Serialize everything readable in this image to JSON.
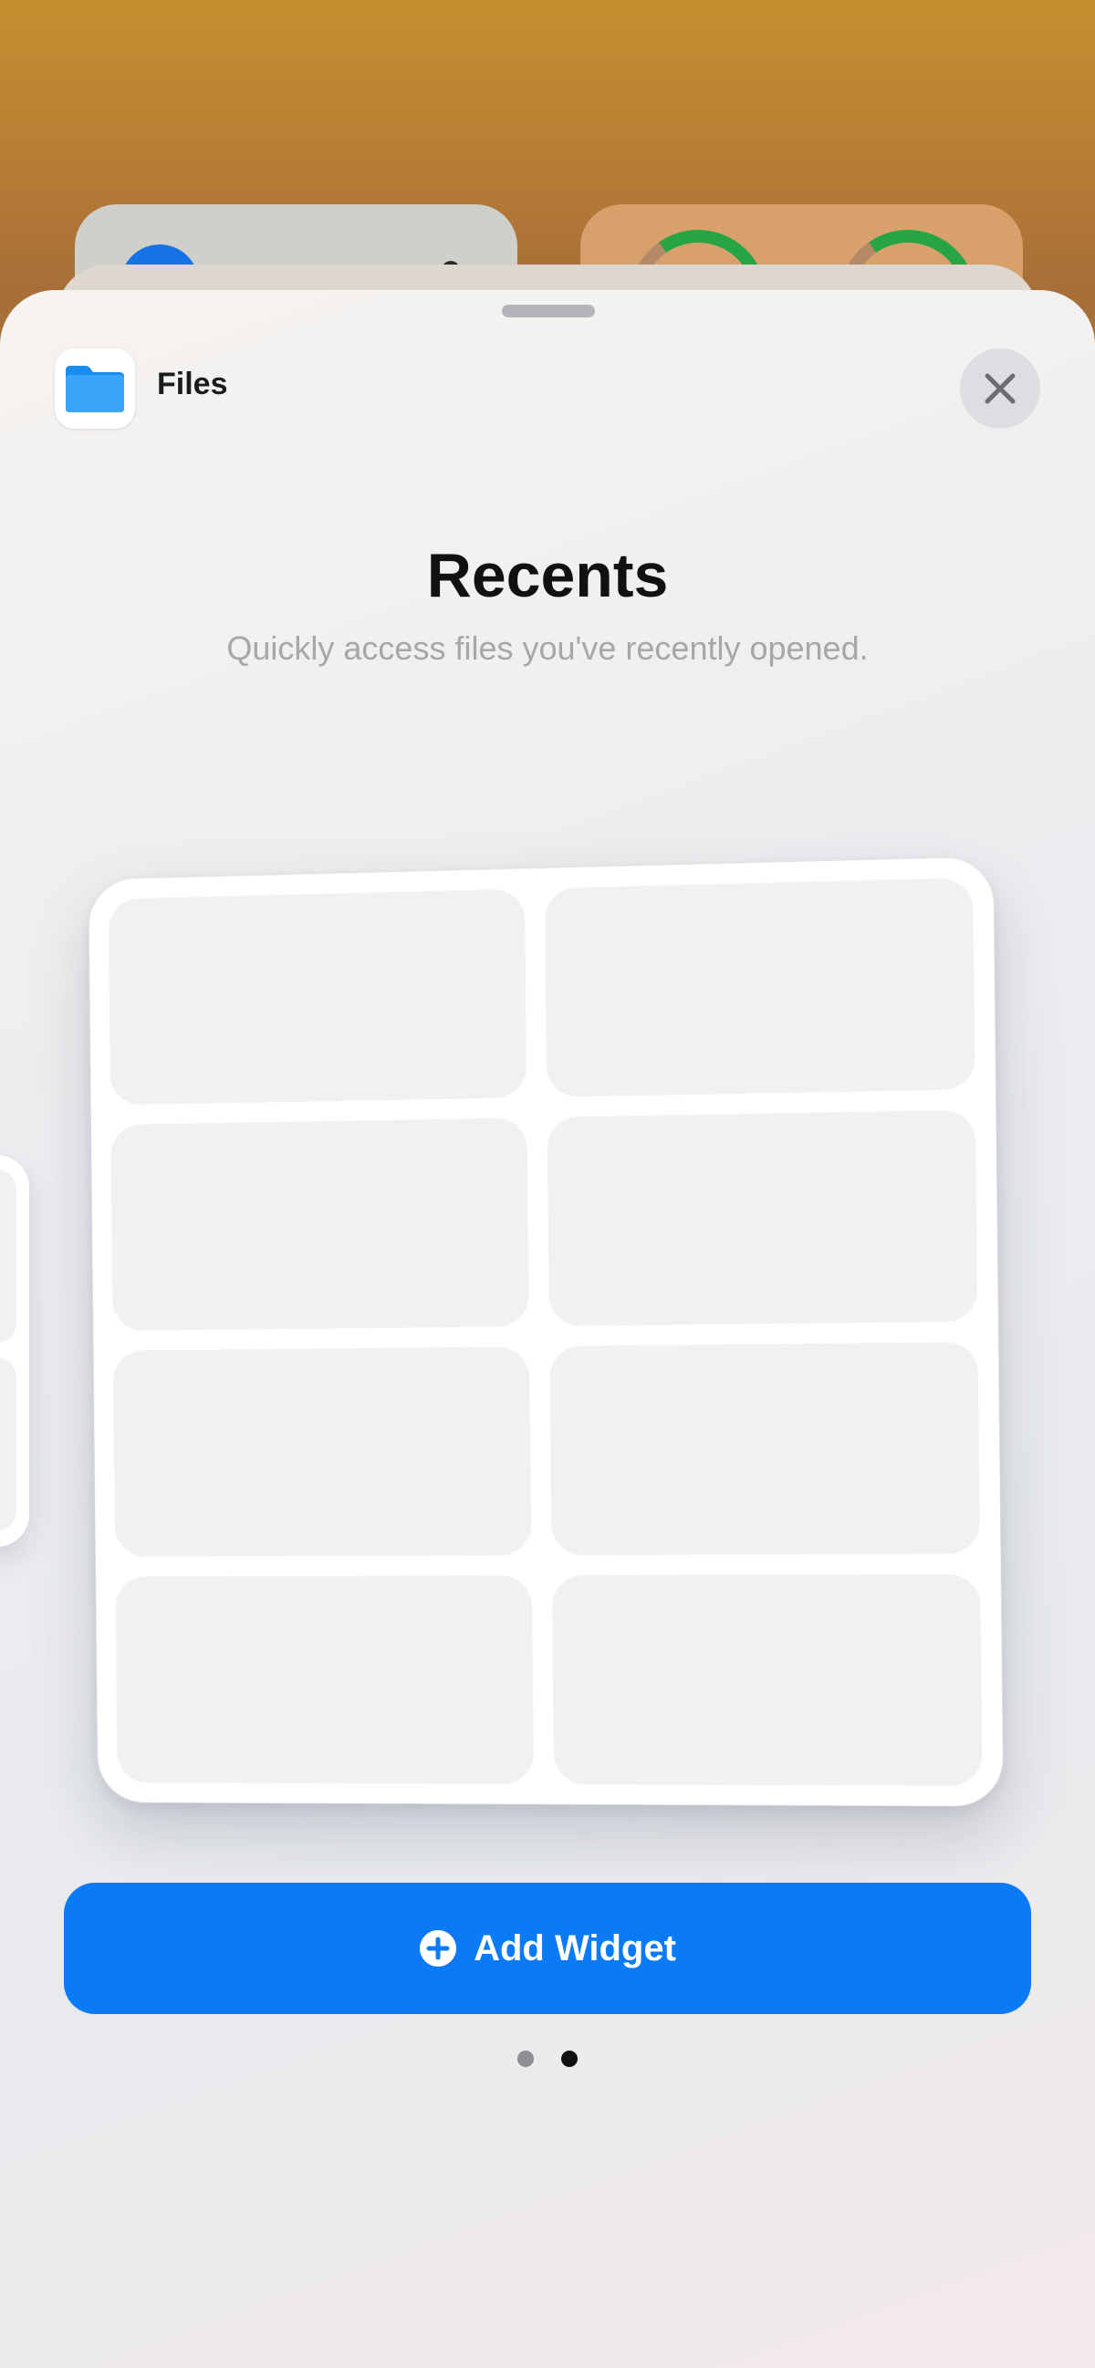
{
  "app": {
    "name": "Files",
    "icon": "folder-icon"
  },
  "widget": {
    "title": "Recents",
    "description": "Quickly access files you've recently opened."
  },
  "pagination": {
    "count": 2,
    "current_index": 1
  },
  "actions": {
    "add_widget_label": "Add Widget",
    "close_icon": "close-icon",
    "add_icon": "plus-circle-icon"
  },
  "colors": {
    "accent": "#0B7BF5",
    "folder": "#1A8CF0"
  }
}
